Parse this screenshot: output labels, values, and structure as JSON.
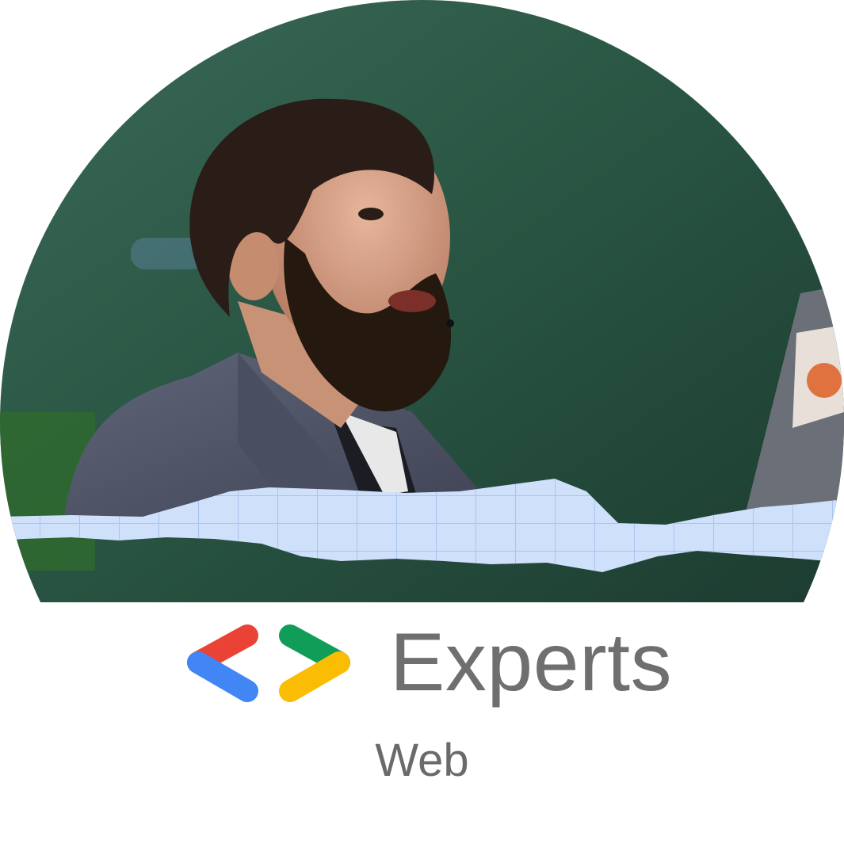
{
  "badge": {
    "program_name": "Experts",
    "category": "Web",
    "logo_icon": "developer-experts-logo-icon",
    "logo_colors": {
      "red": "#ea4335",
      "blue": "#4285f4",
      "green": "#0f9d58",
      "yellow": "#fbbc04"
    }
  },
  "photo": {
    "subject": "speaker-portrait",
    "background_color": "#244a3a",
    "paper_color": "#cfe0fb"
  }
}
